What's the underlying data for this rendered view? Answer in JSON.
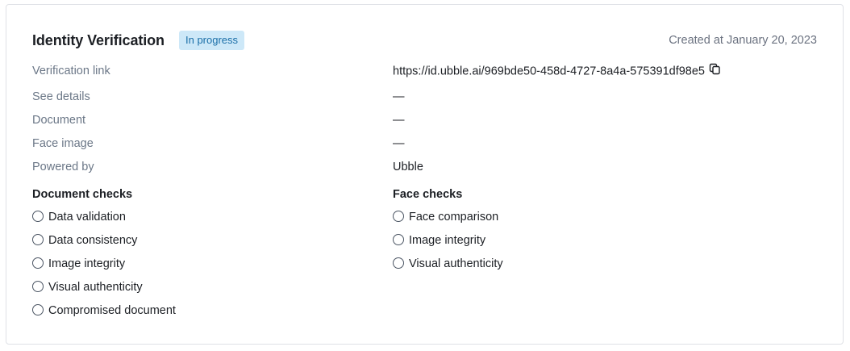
{
  "header": {
    "title": "Identity Verification",
    "status_badge": "In progress",
    "created": "Created at January 20, 2023"
  },
  "details": [
    {
      "label": "Verification link",
      "value": "https://id.ubble.ai/969bde50-458d-4727-8a4a-575391df98e5"
    },
    {
      "label": "See details",
      "value": "—"
    },
    {
      "label": "Document",
      "value": "—"
    },
    {
      "label": "Face image",
      "value": "—"
    },
    {
      "label": "Powered by",
      "value": "Ubble"
    }
  ],
  "document_checks": {
    "title": "Document checks",
    "items": [
      "Data validation",
      "Data consistency",
      "Image integrity",
      "Visual authenticity",
      "Compromised document"
    ]
  },
  "face_checks": {
    "title": "Face checks",
    "items": [
      "Face comparison",
      "Image integrity",
      "Visual authenticity"
    ]
  },
  "icons": {
    "copy": "copy-icon",
    "check_status": "radio-circle-icon"
  },
  "colors": {
    "badge_bg": "#cde8f8",
    "badge_text": "#1b6fa8",
    "label": "#6b7787"
  }
}
